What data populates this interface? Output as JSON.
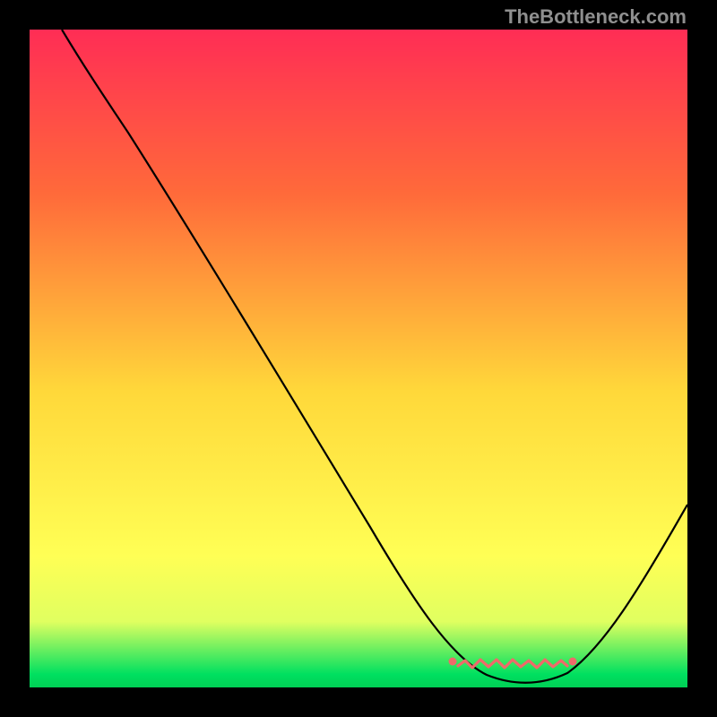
{
  "watermark": "TheBottleneck.com",
  "colors": {
    "curve": "#000000",
    "scribble": "#ef6a6a"
  },
  "chart_data": {
    "type": "line",
    "title": "",
    "xlabel": "",
    "ylabel": "",
    "xlim": [
      0,
      100
    ],
    "ylim": [
      0,
      100
    ],
    "grid": false,
    "series": [
      {
        "name": "curve",
        "x": [
          5,
          10,
          15,
          20,
          30,
          40,
          50,
          60,
          65,
          70,
          75,
          80,
          85,
          90,
          100
        ],
        "values": [
          100,
          95,
          88,
          80,
          64,
          48,
          32,
          16,
          10,
          5,
          2,
          2,
          4,
          11,
          28
        ]
      }
    ],
    "annotation_segment": {
      "name": "threshold-scribble",
      "x_start": 65,
      "x_end": 85,
      "y": 3
    }
  }
}
